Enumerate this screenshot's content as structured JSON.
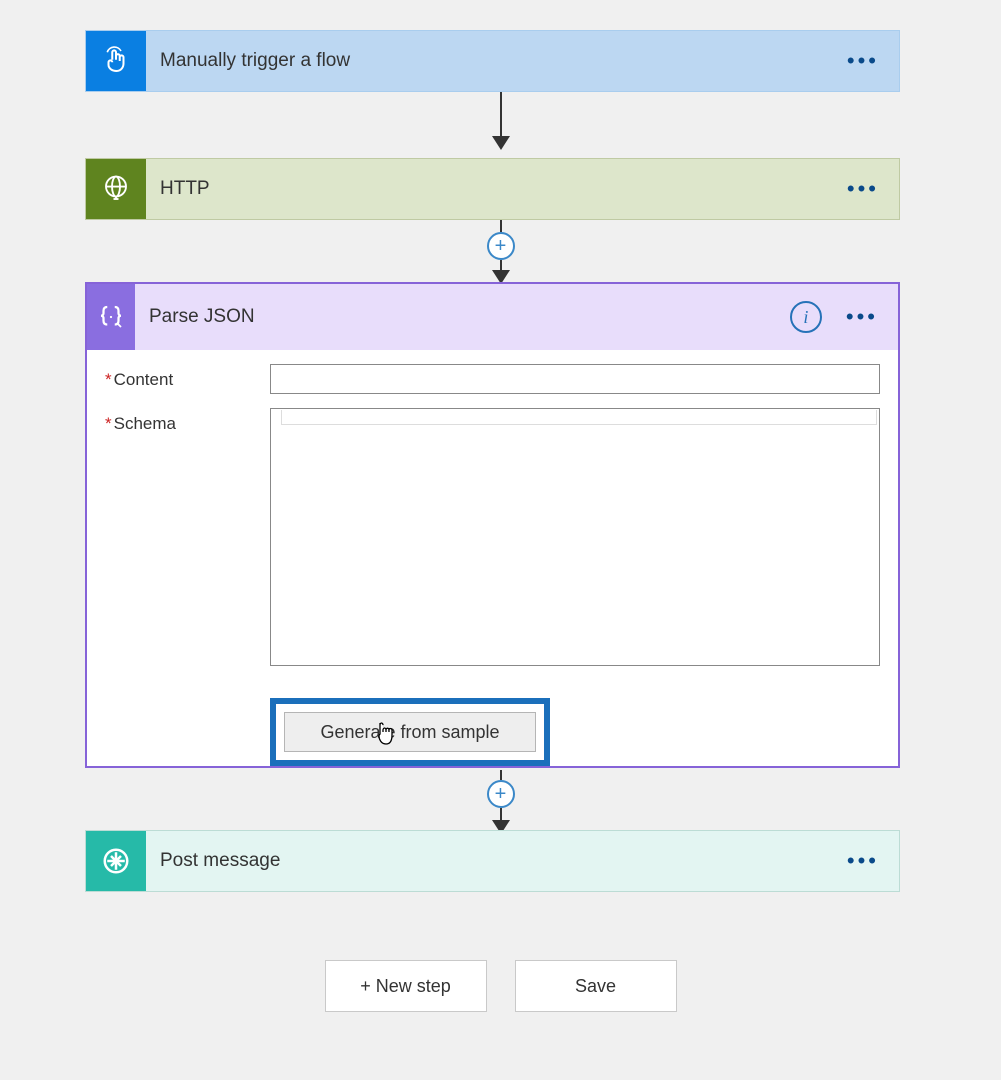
{
  "steps": {
    "trigger": {
      "title": "Manually trigger a flow"
    },
    "http": {
      "title": "HTTP"
    },
    "parse": {
      "title": "Parse JSON",
      "fields": {
        "content": {
          "label": "Content",
          "required": "*",
          "value": ""
        },
        "schema": {
          "label": "Schema",
          "required": "*",
          "value": ""
        }
      },
      "generate_button": "Generate from sample"
    },
    "post": {
      "title": "Post message"
    }
  },
  "designer": {
    "new_step": "+ New step",
    "save": "Save"
  }
}
